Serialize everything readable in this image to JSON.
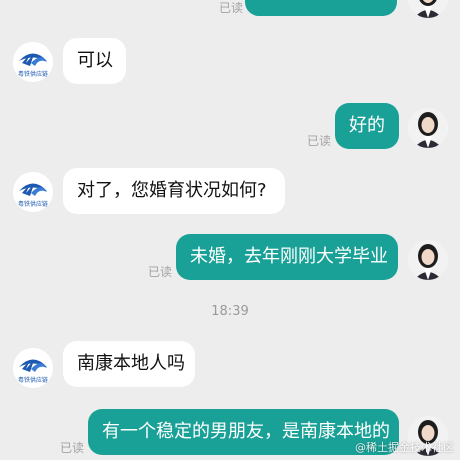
{
  "messages": [
    {
      "side": "out",
      "text": "",
      "status": "已读"
    },
    {
      "side": "in",
      "text": "可以",
      "sender_caption": "粤铁供应链"
    },
    {
      "side": "out",
      "text": "好的",
      "status": "已读"
    },
    {
      "side": "in",
      "text": "对了，您婚育状况如何?",
      "sender_caption": "粤铁供应链"
    },
    {
      "side": "out",
      "text": "未婚，去年刚刚大学毕业",
      "status": "已读"
    },
    {
      "side": "in",
      "text": "南康本地人吗",
      "sender_caption": "粤铁供应链"
    },
    {
      "side": "out",
      "text": "有一个稳定的男朋友，是南康本地的",
      "status": "已读"
    }
  ],
  "timestamp": "18:39",
  "watermark": "@稀土掘金技术社区",
  "colors": {
    "background": "#ededed",
    "outgoing_bubble": "#1aa197",
    "incoming_bubble": "#ffffff",
    "read_status": "#a3a3a3"
  },
  "icons": {
    "company_avatar": "company-logo-icon",
    "user_avatar": "user-avatar-icon"
  }
}
